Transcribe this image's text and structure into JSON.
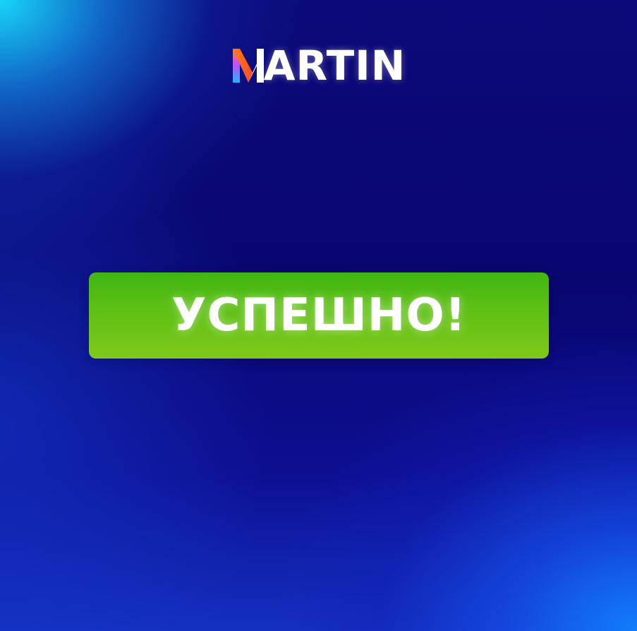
{
  "brand": {
    "logo_text": "ARTIN",
    "logo_initial": "M",
    "logo_mark_colors": [
      "#1fb6ff",
      "#2d63ff",
      "#ff7a1a"
    ]
  },
  "status": {
    "message": "УСПЕШНО!",
    "color": "#5cbf14"
  },
  "background": {
    "base": "#0a0673",
    "accent_top_left": "#18e0ff",
    "accent_bottom_right": "#1282ff"
  }
}
